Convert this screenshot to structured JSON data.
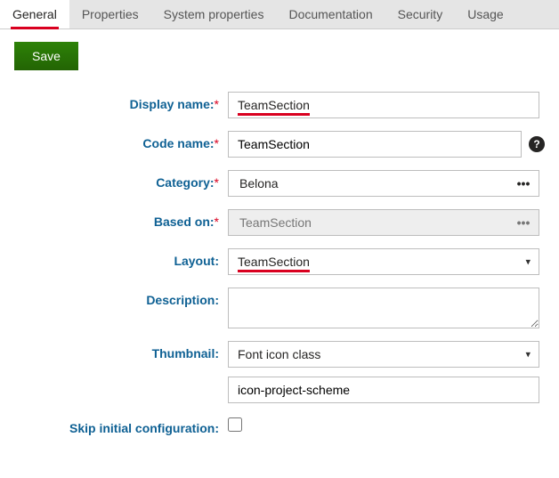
{
  "tabs": {
    "items": [
      {
        "label": "General",
        "active": true
      },
      {
        "label": "Properties",
        "active": false
      },
      {
        "label": "System properties",
        "active": false
      },
      {
        "label": "Documentation",
        "active": false
      },
      {
        "label": "Security",
        "active": false
      },
      {
        "label": "Usage",
        "active": false
      }
    ]
  },
  "toolbar": {
    "save_label": "Save"
  },
  "form": {
    "display_name": {
      "label": "Display name:",
      "value": "TeamSection",
      "required": true
    },
    "code_name": {
      "label": "Code name:",
      "value": "TeamSection",
      "required": true
    },
    "category": {
      "label": "Category:",
      "value": "Belona",
      "required": true
    },
    "based_on": {
      "label": "Based on:",
      "value": "TeamSection",
      "required": true
    },
    "layout": {
      "label": "Layout:",
      "value": "TeamSection"
    },
    "description": {
      "label": "Description:",
      "value": ""
    },
    "thumbnail": {
      "label": "Thumbnail:",
      "type_value": "Font icon class",
      "class_value": "icon-project-scheme"
    },
    "skip_initial": {
      "label": "Skip initial configuration:",
      "checked": false
    }
  },
  "icons": {
    "more": "•••",
    "help": "?"
  }
}
